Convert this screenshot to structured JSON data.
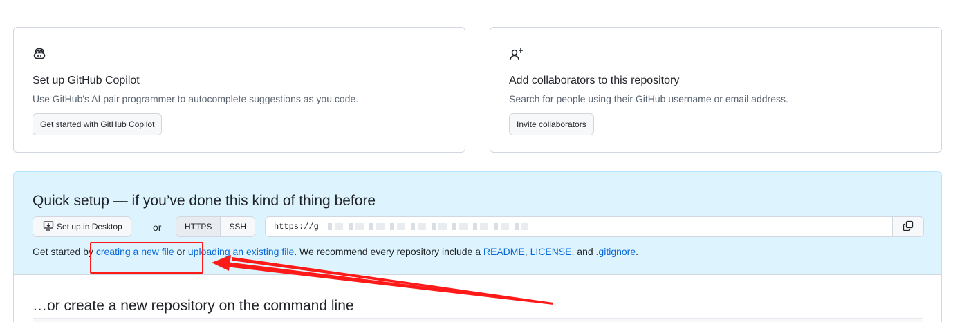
{
  "copilot_card": {
    "title": "Set up GitHub Copilot",
    "description": "Use GitHub's AI pair programmer to autocomplete suggestions as you code.",
    "button": "Get started with GitHub Copilot"
  },
  "collab_card": {
    "title": "Add collaborators to this repository",
    "description": "Search for people using their GitHub username or email address.",
    "button": "Invite collaborators"
  },
  "quick_setup": {
    "title": "Quick setup — if you’ve done this kind of thing before",
    "desktop_button": "Set up in Desktop",
    "or": "or",
    "protocols": [
      "HTTPS",
      "SSH"
    ],
    "selected_protocol": "HTTPS",
    "clone_url_visible": "https://g",
    "get_started": {
      "prefix": "Get started by ",
      "link_new_file": "creating a new file",
      "mid1": " or ",
      "link_upload": "uploading an existing file",
      "mid2": ". We recommend every repository include a ",
      "link_readme": "README",
      "sep1": ", ",
      "link_license": "LICENSE",
      "sep2": ", and ",
      "link_gitignore": ".gitignore",
      "suffix": "."
    }
  },
  "command_line": {
    "title": "…or create a new repository on the command line"
  },
  "colors": {
    "link": "#0969da",
    "quick_bg": "#ddf4ff",
    "annotation": "#ff1a1a"
  }
}
